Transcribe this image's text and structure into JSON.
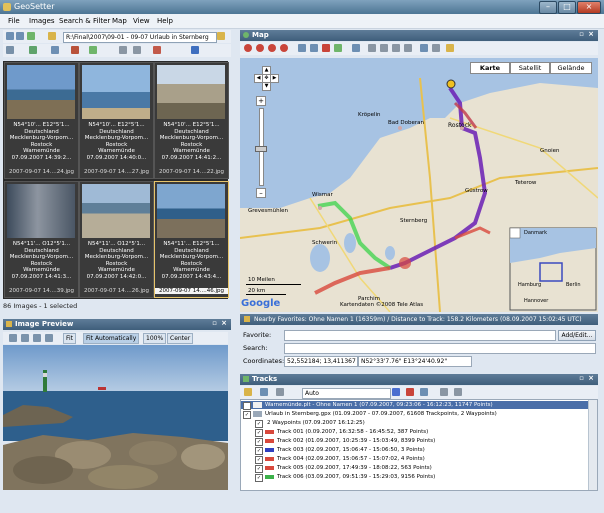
{
  "window": {
    "title": "GeoSetter"
  },
  "menu": [
    "File",
    "Images",
    "Search & Filter",
    "Map",
    "View",
    "Help"
  ],
  "toolbar": {
    "path": "R:\\Final\\2007\\09-01 - 09-07 Urlaub in Sternberg"
  },
  "images_panel": {
    "thumbnails": [
      {
        "coords": "N54°10'... E12°5'1...",
        "country": "Deutschland",
        "state": "Mecklenburg-Vorpom...",
        "city": "Rostock",
        "place": "Warnemünde",
        "datetime": "07.09.2007 14:39:2...",
        "filename": "2007-09-07 14....24.jpg"
      },
      {
        "coords": "N54°10'... E12°5'1...",
        "country": "Deutschland",
        "state": "Mecklenburg-Vorpom...",
        "city": "Rostock",
        "place": "Warnemünde",
        "datetime": "07.09.2007 14:40:0...",
        "filename": "2007-09-07 14....27.jpg"
      },
      {
        "coords": "N54°10'... E12°5'1...",
        "country": "Deutschland",
        "state": "Mecklenburg-Vorpom...",
        "city": "Rostock",
        "place": "Warnemünde",
        "datetime": "07.09.2007 14:41:2...",
        "filename": "2007-09-07 14....22.jpg"
      },
      {
        "coords": "N54°11'... O12°5'1...",
        "country": "Deutschland",
        "state": "Mecklenburg-Vorpom...",
        "city": "Rostock",
        "place": "Warnemünde",
        "datetime": "07.09.2007 14:41:3...",
        "filename": "2007-09-07 14....39.jpg"
      },
      {
        "coords": "N54°11'... O12°5'1...",
        "country": "Deutschland",
        "state": "Mecklenburg-Vorpom...",
        "city": "Rostock",
        "place": "Warnemünde",
        "datetime": "07.09.2007 14:42:0...",
        "filename": "2007-09-07 14....26.jpg"
      },
      {
        "coords": "N54°11'... E12°5'1...",
        "country": "Deutschland",
        "state": "Mecklenburg-Vorpom...",
        "city": "Rostock",
        "place": "Warnemünde",
        "datetime": "07.09.2007 14:43:4...",
        "filename": "2007-09-07 14....46.jpg"
      }
    ],
    "status": "86 Images - 1 selected"
  },
  "preview_panel": {
    "title": "Image Preview",
    "fit": "Fit",
    "fit_auto": "Fit Automatically",
    "zoom": "100%",
    "center": "Center"
  },
  "map_panel": {
    "title": "Map",
    "types": [
      "Karte",
      "Satellit",
      "Gelände"
    ],
    "scale_miles": "10 Meilen",
    "scale_km": "20 km",
    "copyright": "Kartendaten ©2008 Tele Atlas",
    "google": "Google",
    "cities": [
      "Rostock",
      "Bad Doberan",
      "Kröpelin",
      "Gnoien",
      "Schwerin",
      "Wismar",
      "Teterow",
      "Güstrow",
      "Sternberg",
      "Grevesmühlen",
      "Parchim"
    ],
    "inset_labels": [
      "Danmark",
      "Hamburg",
      "Berlin",
      "Hannover"
    ]
  },
  "favorites_bar": {
    "text": "Nearby Favorites: Ohne Namen 1 (16359m) / Distance to Track: 158.2 Kilometers (08.09.2007 15:02:45 UTC)"
  },
  "form": {
    "favorite_label": "Favorite:",
    "add_edit": "Add/Edit...",
    "search_label": "Search:",
    "coordinates_label": "Coordinates:",
    "coord_decimal": "52,552184; 13,411367",
    "coord_dms": "N52°33'7.76\" E13°24'40.92\""
  },
  "tracks_panel": {
    "title": "Tracks",
    "mode": "Auto",
    "rows": [
      {
        "text": "Warnemünde.plt - Ohne Namen 1 (07.09.2007, 09:23:06 - 16:12:23, 11747 Points)",
        "level": 0,
        "color": "",
        "selected": true
      },
      {
        "text": "Urlaub in Sternberg.gpx (01.09.2007 - 07.09.2007, 61608 Trackpoints, 2 Waypoints)",
        "level": 0,
        "color": "",
        "selected": false
      },
      {
        "text": "2 Waypoints (07.09.2007 16:12:25)",
        "level": 1,
        "color": "",
        "selected": false
      },
      {
        "text": "Track 001 (0.09.2007, 16:32:58 - 16:45:52, 387 Points)",
        "level": 1,
        "color": "#d8483c",
        "selected": false
      },
      {
        "text": "Track 002 (01.09.2007, 10:25:39 - 15:03:49, 8399 Points)",
        "level": 1,
        "color": "#d8483c",
        "selected": false
      },
      {
        "text": "Track 003 (02.09.2007, 15:06:47 - 15:06:50, 3 Points)",
        "level": 1,
        "color": "#2f3fbf",
        "selected": false
      },
      {
        "text": "Track 004 (02.09.2007, 15:06:57 - 15:07:02, 4 Points)",
        "level": 1,
        "color": "#d8483c",
        "selected": false
      },
      {
        "text": "Track 005 (02.09.2007, 17:49:39 - 18:08:22, 563 Points)",
        "level": 1,
        "color": "#d8483c",
        "selected": false
      },
      {
        "text": "Track 006 (03.09.2007, 09:51:39 - 15:29:03, 9156 Points)",
        "level": 1,
        "color": "#3bb04a",
        "selected": false
      }
    ]
  },
  "colors": {
    "panel_header": "#4f6f8d",
    "selection": "#e7c46a",
    "track_purple": "#6a1fb5"
  }
}
